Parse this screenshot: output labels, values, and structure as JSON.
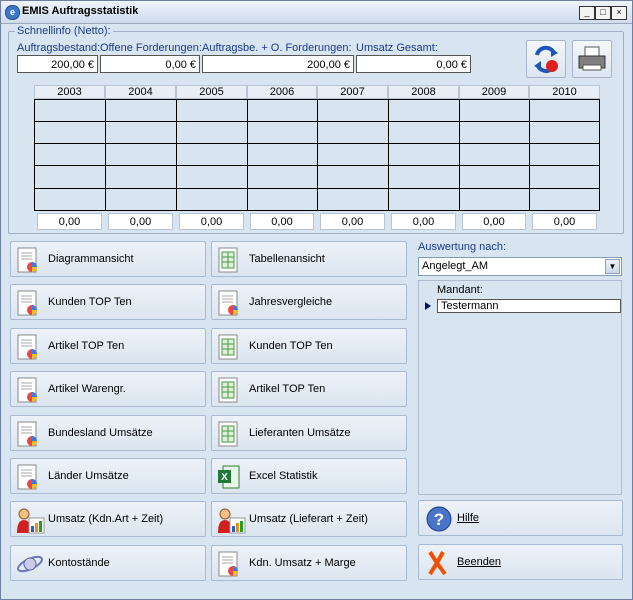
{
  "window": {
    "title": "EMIS Auftragsstatistik",
    "controls": [
      "_",
      "□",
      "×"
    ]
  },
  "schnellinfo": {
    "legend": "Schnellinfo (Netto):",
    "fields": [
      {
        "label": "Auftragsbestand:",
        "value": "200,00 €"
      },
      {
        "label": "Offene Forderungen:",
        "value": "0,00 €"
      },
      {
        "label": "Auftragsbe. + O. Forderungen:",
        "value": "200,00 €"
      },
      {
        "label": "Umsatz Gesamt:",
        "value": "0,00 €"
      }
    ]
  },
  "years": [
    "2003",
    "2004",
    "2005",
    "2006",
    "2007",
    "2008",
    "2009",
    "2010"
  ],
  "totals": [
    "0,00",
    "0,00",
    "0,00",
    "0,00",
    "0,00",
    "0,00",
    "0,00",
    "0,00"
  ],
  "buttons_left": [
    {
      "label": "Diagrammansicht",
      "icon": "chart-doc-icon"
    },
    {
      "label": "Kunden TOP Ten",
      "icon": "chart-doc-icon"
    },
    {
      "label": "Artikel TOP Ten",
      "icon": "chart-doc-icon"
    },
    {
      "label": "Artikel Warengr.",
      "icon": "chart-doc-icon"
    },
    {
      "label": "Bundesland Umsätze",
      "icon": "chart-doc-icon"
    },
    {
      "label": "Länder Umsätze",
      "icon": "chart-doc-icon"
    },
    {
      "label": "Umsatz (Kdn.Art + Zeit)",
      "icon": "person-chart-icon"
    },
    {
      "label": "Kontostände",
      "icon": "planet-icon"
    }
  ],
  "buttons_mid": [
    {
      "label": "Tabellenansicht",
      "icon": "table-doc-icon"
    },
    {
      "label": "Jahresvergleiche",
      "icon": "chart-doc-icon"
    },
    {
      "label": "Kunden TOP Ten",
      "icon": "table-doc-icon"
    },
    {
      "label": "Artikel TOP Ten",
      "icon": "table-doc-icon"
    },
    {
      "label": "Lieferanten Umsätze",
      "icon": "table-doc-icon"
    },
    {
      "label": "Excel Statistik",
      "icon": "excel-icon"
    },
    {
      "label": "Umsatz (Lieferart + Zeit)",
      "icon": "person-chart-icon"
    },
    {
      "label": "Kdn. Umsatz + Marge",
      "icon": "chart-doc-icon"
    }
  ],
  "auswertung": {
    "label": "Auswertung nach:",
    "selected": "Angelegt_AM",
    "list_header": "Mandant:",
    "rows": [
      "Testermann"
    ]
  },
  "help_label": "Hilfe",
  "exit_label": "Beenden"
}
